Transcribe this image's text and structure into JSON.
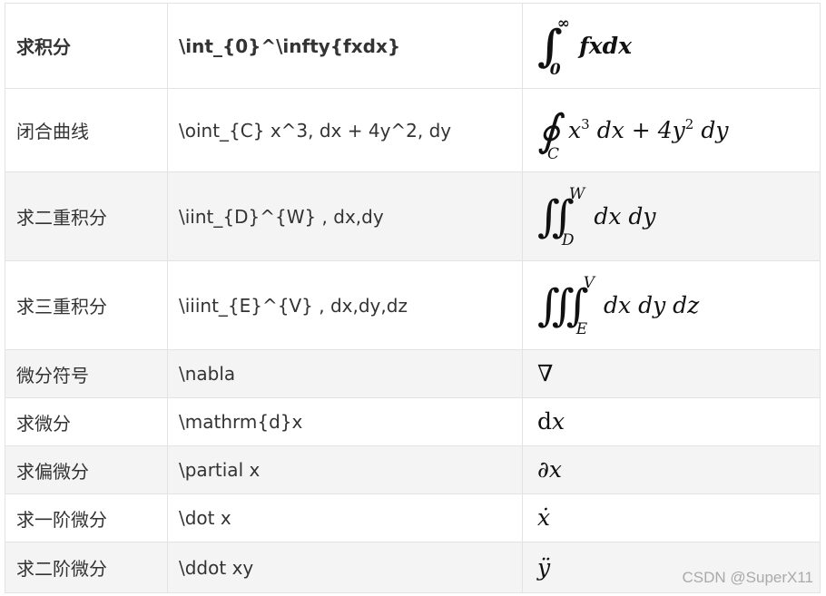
{
  "rows": [
    {
      "name": "求积分",
      "code": "\\int_{0}^\\infty{fxdx}",
      "bold": true
    },
    {
      "name": "闭合曲线",
      "code": "\\oint_{C} x^3, dx + 4y^2, dy"
    },
    {
      "name": "求二重积分",
      "code": "\\iint_{D}^{W} , dx,dy"
    },
    {
      "name": "求三重积分",
      "code": "\\iiint_{E}^{V} , dx,dy,dz"
    },
    {
      "name": "微分符号",
      "code": "\\nabla"
    },
    {
      "name": "求微分",
      "code": "\\mathrm{d}x"
    },
    {
      "name": "求偏微分",
      "code": "\\partial x"
    },
    {
      "name": "求一阶微分",
      "code": "\\dot x"
    },
    {
      "name": "求二阶微分",
      "code": "\\ddot xy"
    }
  ],
  "render": {
    "r0": {
      "sym": "∫",
      "upper": "∞",
      "lower": "0",
      "body": "fxdx"
    },
    "r1": {
      "sym": "∮",
      "lower": "C",
      "x": "x",
      "exp3": "3",
      "dx": "dx",
      "plus": "+",
      "four_y": "4y",
      "exp2": "2",
      "dy": "dy"
    },
    "r2": {
      "sym": "∬",
      "upper": "W",
      "lower": "D",
      "body": "dx dy"
    },
    "r3": {
      "sym": "∭",
      "upper": "V",
      "lower": "E",
      "body": "dx dy dz"
    },
    "r4": {
      "body": "∇"
    },
    "r5": {
      "d": "d",
      "x": "x"
    },
    "r6": {
      "body": "∂x"
    },
    "r7": {
      "body": "ẋ"
    },
    "r8": {
      "body": "ÿ"
    }
  },
  "watermark": "CSDN @SuperX11"
}
